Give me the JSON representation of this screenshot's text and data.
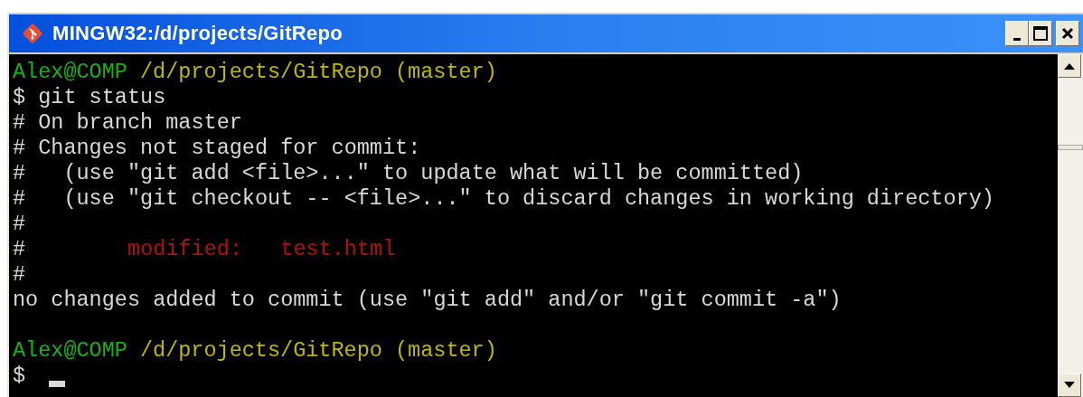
{
  "window": {
    "title": "MINGW32:/d/projects/GitRepo",
    "buttons": [
      {
        "kind": "minimize"
      },
      {
        "kind": "maximize"
      },
      {
        "kind": "close"
      }
    ]
  },
  "terminal": {
    "lines": [
      [
        {
          "kind": "user",
          "text": "Alex@COMP"
        },
        {
          "kind": "path",
          "text": "/d/projects/GitRepo (master)"
        }
      ],
      [
        {
          "kind": "plain",
          "text": "$ git status"
        }
      ],
      [
        {
          "kind": "plain",
          "text": "# On branch master"
        }
      ],
      [
        {
          "kind": "plain",
          "text": "# Changes not staged for commit:"
        }
      ],
      [
        {
          "kind": "plain",
          "text": "#   (use \"git add <file>...\" to update what will be committed)"
        }
      ],
      [
        {
          "kind": "plain",
          "text": "#   (use \"git checkout -- <file>...\" to discard changes in working directory)"
        }
      ],
      [
        {
          "kind": "plain",
          "text": "#"
        }
      ],
      [
        {
          "kind": "plain",
          "text": "#"
        },
        {
          "kind": "modified",
          "text": "modified:   test.html"
        }
      ],
      [
        {
          "kind": "plain",
          "text": "#"
        }
      ],
      [
        {
          "kind": "plain",
          "text": "no changes added to commit (use \"git add\" and/or \"git commit -a\")"
        }
      ],
      [
        {
          "kind": "blank"
        }
      ],
      [
        {
          "kind": "user",
          "text": "Alex@COMP"
        },
        {
          "kind": "path",
          "text": "/d/projects/GitRepo (master)"
        }
      ],
      [
        {
          "kind": "plain",
          "text": "$"
        },
        {
          "kind": "cursor"
        }
      ]
    ]
  }
}
